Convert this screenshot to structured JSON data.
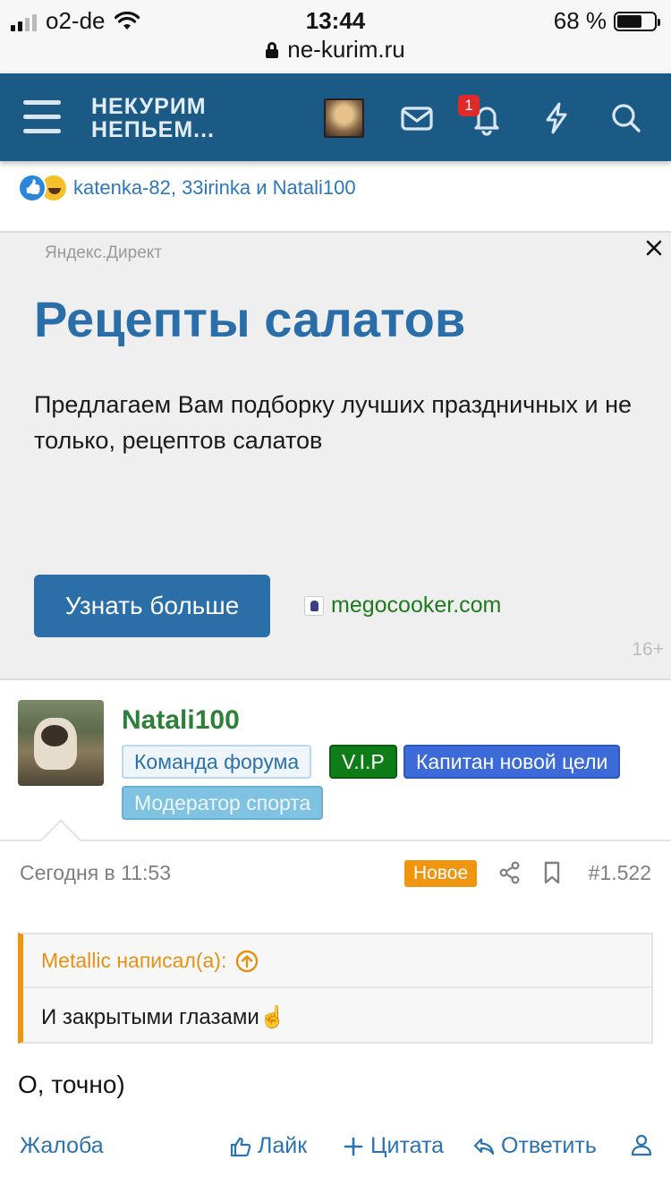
{
  "status_bar": {
    "carrier": "o2-de",
    "time": "13:44",
    "battery": "68 %",
    "battery_level": 0.68,
    "url": "ne-kurim.ru"
  },
  "header": {
    "logo_line1": "НЕКУРИМ",
    "logo_line2": "НЕПЬЕМ...",
    "notifications_count": "1",
    "icons": [
      "menu-icon",
      "mail-icon",
      "bell-icon",
      "lightning-icon",
      "search-icon"
    ]
  },
  "reactions": {
    "names": "katenka-82, 33irinka и Natali100",
    "icons": [
      "like-icon",
      "laugh-icon"
    ]
  },
  "ad": {
    "source": "Яндекс.Директ",
    "title": "Рецепты салатов",
    "text": "Предлагаем Вам подборку лучших празднич­ных и не только, рецептов салатов",
    "button": "Узнать больше",
    "site": "megocooker.com",
    "age": "16+"
  },
  "post": {
    "author": "Natali100",
    "badges": {
      "team": "Команда форума",
      "vip": "V.I.P",
      "captain": "Капитан новой цели",
      "moderator": "Модератор спорта"
    },
    "time": "Сегодня в 11:53",
    "new_label": "Новое",
    "number": "#1.522",
    "quote_author": "Metallic написал(а):",
    "quote_text": "И закрытыми глазами☝️",
    "body": "О, точно)"
  },
  "actions": {
    "report": "Жалоба",
    "like": "Лайк",
    "quote": "Цитата",
    "reply": "Ответить"
  },
  "colors": {
    "header_bg": "#1c5a86",
    "link": "#2b72b0",
    "username": "#2e7f39",
    "accent_orange": "#f0950f"
  }
}
